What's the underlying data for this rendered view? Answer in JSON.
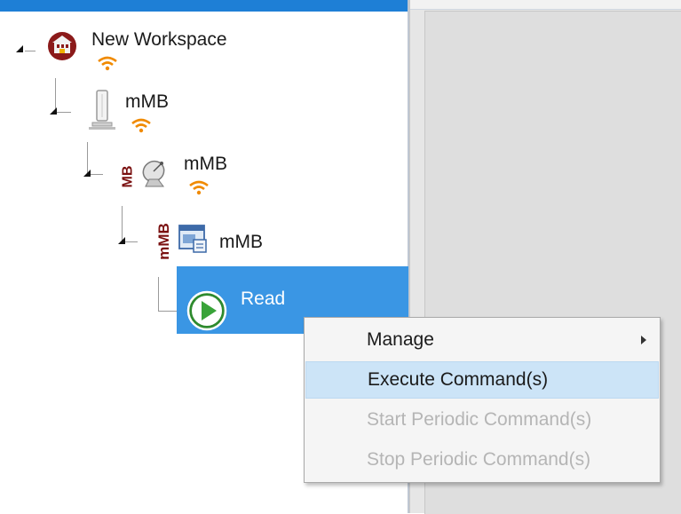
{
  "tree": {
    "root": {
      "label": "New Workspace",
      "icon": "workspace-icon",
      "status_icon": "wifi-icon"
    },
    "level1": {
      "label": "mMB",
      "icon": "device-icon",
      "status_icon": "wifi-icon"
    },
    "level2": {
      "label": "mMB",
      "tag": "MB",
      "icon": "satellite-dish-icon",
      "status_icon": "wifi-icon"
    },
    "level3": {
      "label": "mMB",
      "tag": "mMB",
      "icon": "window-icon"
    },
    "level4": {
      "label": "Read",
      "icon": "play-icon"
    }
  },
  "context_menu": {
    "items": [
      {
        "label": "Manage",
        "state": "normal",
        "has_submenu": true
      },
      {
        "label": "Execute Command(s)",
        "state": "highlighted"
      },
      {
        "label": "Start Periodic Command(s)",
        "state": "disabled"
      },
      {
        "label": "Stop Periodic Command(s)",
        "state": "disabled"
      }
    ]
  },
  "colors": {
    "selection": "#3a96e4",
    "menu_highlight": "#cce4f7",
    "wifi": "#f08a00",
    "mb_tag": "#7a1010"
  }
}
